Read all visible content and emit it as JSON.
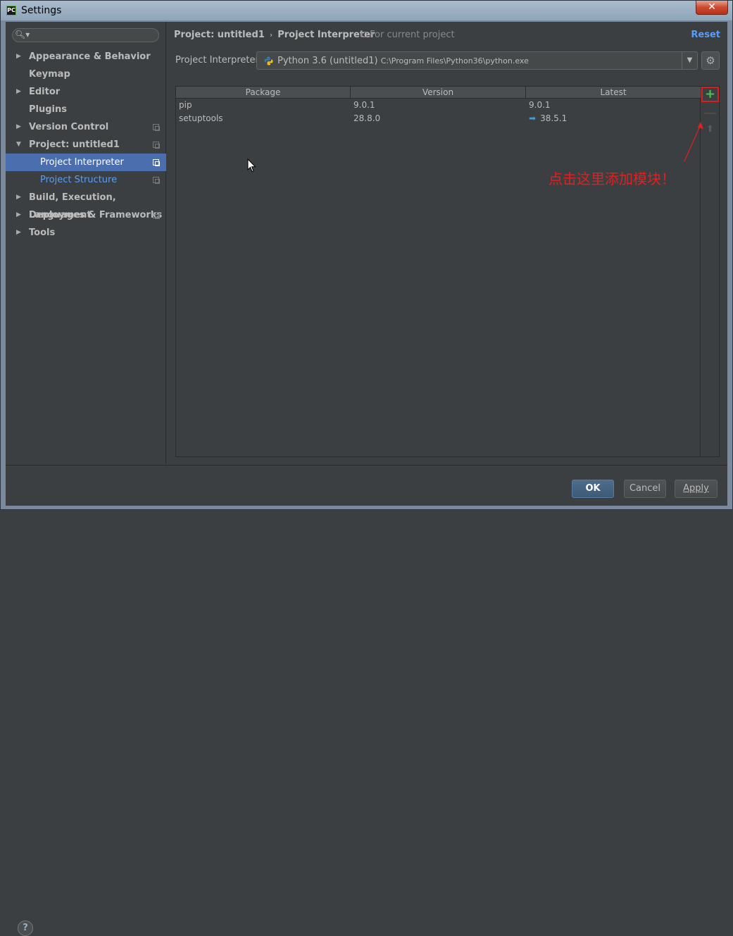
{
  "window": {
    "title": "Settings",
    "app_icon_label": "PC",
    "close_label": "✕"
  },
  "search": {
    "icon": "search-icon",
    "placeholder": ""
  },
  "sidebar": {
    "items": [
      {
        "label": "Appearance & Behavior",
        "expandable": true,
        "expanded": false
      },
      {
        "label": "Keymap",
        "expandable": false
      },
      {
        "label": "Editor",
        "expandable": true,
        "expanded": false
      },
      {
        "label": "Plugins",
        "expandable": false
      },
      {
        "label": "Version Control",
        "expandable": true,
        "expanded": false,
        "project_scoped": true
      },
      {
        "label": "Project: untitled1",
        "expandable": true,
        "expanded": true,
        "project_scoped": true
      },
      {
        "label": "Project Interpreter",
        "child": true,
        "selected": true,
        "project_scoped": true
      },
      {
        "label": "Project Structure",
        "child": true,
        "project_scoped": true
      },
      {
        "label": "Build, Execution, Deployment",
        "expandable": true,
        "expanded": false
      },
      {
        "label": "Languages & Frameworks",
        "expandable": true,
        "expanded": false,
        "project_scoped": true
      },
      {
        "label": "Tools",
        "expandable": true,
        "expanded": false
      }
    ]
  },
  "header": {
    "breadcrumb_project": "Project: untitled1",
    "breadcrumb_sep": "›",
    "breadcrumb_page": "Project Interpreter",
    "scope_label": "For current project",
    "reset_label": "Reset"
  },
  "interpreter": {
    "label": "Project Interpreter:",
    "name": "Python 3.6 (untitled1)",
    "path": "C:\\Program Files\\Python36\\python.exe",
    "dropdown_icon": "▼",
    "gear_icon": "⚙"
  },
  "packages": {
    "columns": [
      "Package",
      "Version",
      "Latest"
    ],
    "rows": [
      {
        "package": "pip",
        "version": "9.0.1",
        "latest": "9.0.1",
        "upgrade": false
      },
      {
        "package": "setuptools",
        "version": "28.8.0",
        "latest": "38.5.1",
        "upgrade": true
      }
    ],
    "add_icon": "+",
    "remove_icon": "—",
    "upgrade_icon": "⬆"
  },
  "annotation": {
    "text": "点击这里添加模块！",
    "color": "#e02020"
  },
  "footer": {
    "help_label": "?",
    "ok_label": "OK",
    "cancel_label": "Cancel",
    "apply_label": "Apply"
  },
  "colors": {
    "accent": "#4b6eaf",
    "link": "#589df6",
    "add_green": "#4ec24e",
    "highlight_red": "#d71f1f"
  }
}
